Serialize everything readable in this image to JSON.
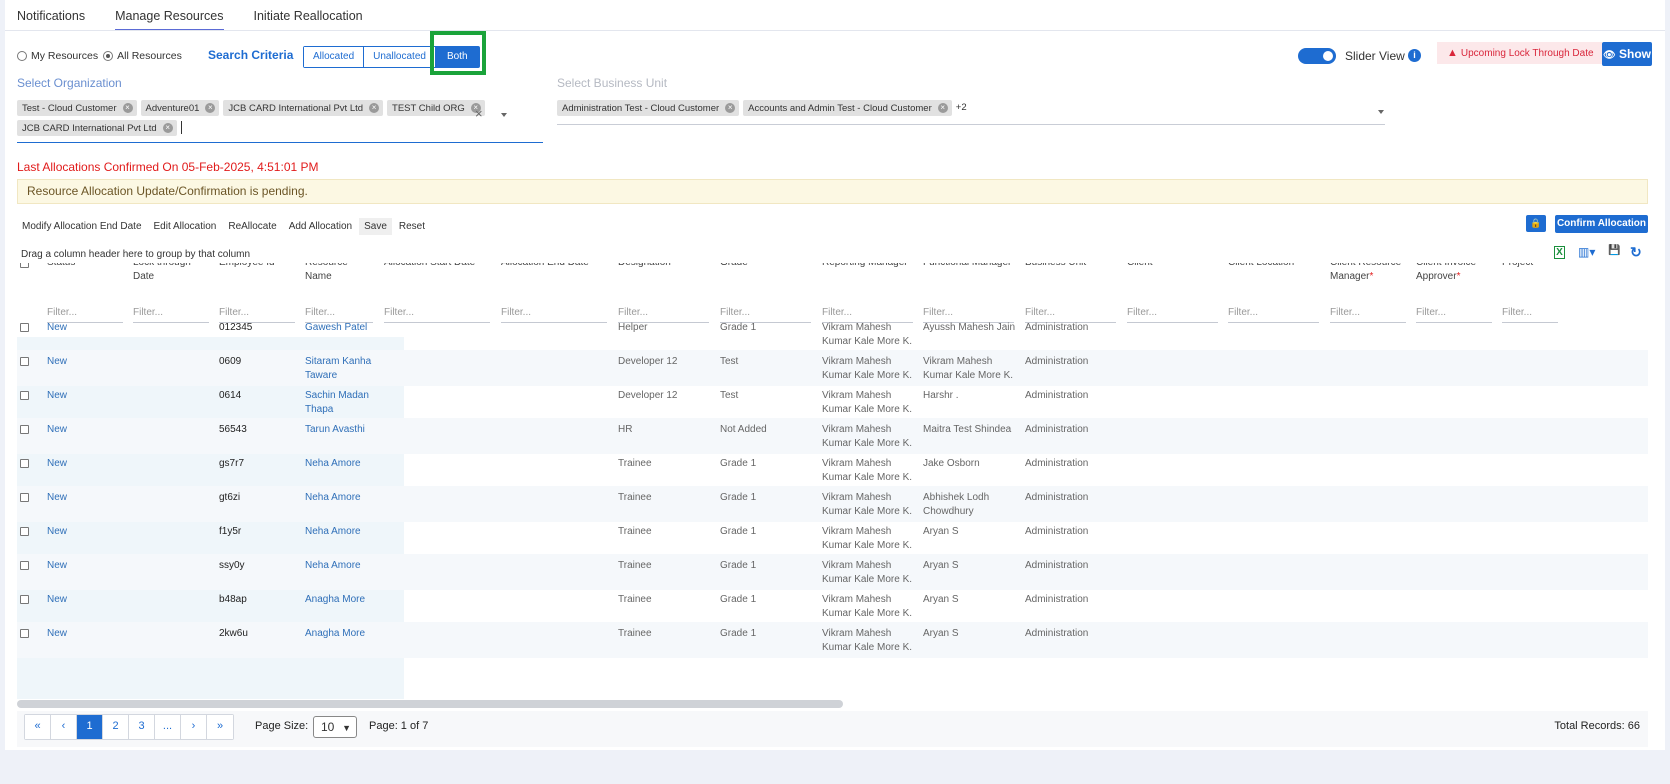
{
  "tabs": [
    "Notifications",
    "Manage Resources",
    "Initiate Reallocation"
  ],
  "scope": {
    "my": "My Resources",
    "all": "All Resources",
    "selected": "All Resources"
  },
  "search_criteria": {
    "label": "Search Criteria",
    "options": [
      "Allocated",
      "Unallocated",
      "Both"
    ],
    "selected": "Both"
  },
  "slider_view": {
    "label": "Slider View",
    "info_glyph": "i",
    "enabled": true
  },
  "lock_badge": {
    "icon": "warning-icon",
    "glyph": "▲",
    "text": "Upcoming Lock Through Date"
  },
  "show_button": {
    "icon": "eye-icon",
    "glyph": "👁",
    "label": "Show"
  },
  "organization": {
    "label": "Select Organization",
    "chips": [
      "Test - Cloud Customer",
      "Adventure01",
      "JCB CARD International Pvt Ltd",
      "TEST Child ORG",
      "JCB CARD International Pvt Ltd"
    ],
    "clear_glyph": "×",
    "chip_x_glyph": "×"
  },
  "business_unit": {
    "label": "Select Business Unit",
    "chips": [
      "Administration Test - Cloud Customer",
      "Accounts and Admin Test - Cloud Customer"
    ],
    "more": "+2"
  },
  "status_message": "Last Allocations Confirmed On 05-Feb-2025, 4:51:01 PM",
  "pending_alert": "Resource Allocation Update/Confirmation is pending.",
  "toolbar": {
    "buttons": [
      "Modify Allocation End Date",
      "Edit Allocation",
      "ReAllocate",
      "Add Allocation",
      "Save",
      "Reset"
    ],
    "lock_glyph": "🔒",
    "confirm_label": "Confirm Allocation"
  },
  "grid": {
    "group_hint": "Drag a column header here to group by that column",
    "tool_icons": {
      "excel": "X",
      "columns": "▥▾",
      "save": "💾",
      "refresh": "↻"
    },
    "filter_placeholder": "Filter...",
    "columns": [
      {
        "label": "Status",
        "required": false
      },
      {
        "label": "Lock through Date",
        "required": false
      },
      {
        "label": "Employee Id",
        "required": false
      },
      {
        "label": "Resource Name",
        "required": false
      },
      {
        "label": "Allocation Start Date",
        "required": true
      },
      {
        "label": "Allocation End Date",
        "required": true
      },
      {
        "label": "Designation",
        "required": false
      },
      {
        "label": "Grade",
        "required": false
      },
      {
        "label": "Reporting Manager",
        "required": false
      },
      {
        "label": "Functional Manager",
        "required": false
      },
      {
        "label": "Business Unit",
        "required": false
      },
      {
        "label": "Client",
        "required": true
      },
      {
        "label": "Client Location",
        "required": true
      },
      {
        "label": "Client Resource Manager",
        "required": true
      },
      {
        "label": "Client Invoice Approver",
        "required": true
      },
      {
        "label": "Project",
        "required": true
      }
    ],
    "rows": [
      [
        "New",
        "",
        "012345",
        "Gawesh Patel",
        "",
        "",
        "Helper",
        "Grade 1",
        "Vikram Mahesh Kumar Kale More K.",
        "Ayussh Mahesh Jain",
        "Administration",
        "",
        "",
        "",
        "",
        ""
      ],
      [
        "New",
        "",
        "0609",
        "Sitaram Kanha Taware",
        "",
        "",
        "Developer 12",
        "Test",
        "Vikram Mahesh Kumar Kale More K.",
        "Vikram Mahesh Kumar Kale More K.",
        "Administration",
        "",
        "",
        "",
        "",
        ""
      ],
      [
        "New",
        "",
        "0614",
        "Sachin Madan Thapa",
        "",
        "",
        "Developer 12",
        "Test",
        "Vikram Mahesh Kumar Kale More K.",
        "Harshr .",
        "Administration",
        "",
        "",
        "",
        "",
        ""
      ],
      [
        "New",
        "",
        "56543",
        "Tarun Avasthi",
        "",
        "",
        "HR",
        "Not Added",
        "Vikram Mahesh Kumar Kale More K.",
        "Maitra Test Shindea",
        "Administration",
        "",
        "",
        "",
        "",
        ""
      ],
      [
        "New",
        "",
        "gs7r7",
        "Neha Amore",
        "",
        "",
        "Trainee",
        "Grade 1",
        "Vikram Mahesh Kumar Kale More K.",
        "Jake Osborn",
        "Administration",
        "",
        "",
        "",
        "",
        ""
      ],
      [
        "New",
        "",
        "gt6zi",
        "Neha Amore",
        "",
        "",
        "Trainee",
        "Grade 1",
        "Vikram Mahesh Kumar Kale More K.",
        "Abhishek Lodh Chowdhury",
        "Administration",
        "",
        "",
        "",
        "",
        ""
      ],
      [
        "New",
        "",
        "f1y5r",
        "Neha Amore",
        "",
        "",
        "Trainee",
        "Grade 1",
        "Vikram Mahesh Kumar Kale More K.",
        "Aryan S",
        "Administration",
        "",
        "",
        "",
        "",
        ""
      ],
      [
        "New",
        "",
        "ssy0y",
        "Neha Amore",
        "",
        "",
        "Trainee",
        "Grade 1",
        "Vikram Mahesh Kumar Kale More K.",
        "Aryan S",
        "Administration",
        "",
        "",
        "",
        "",
        ""
      ],
      [
        "New",
        "",
        "b48ap",
        "Anagha More",
        "",
        "",
        "Trainee",
        "Grade 1",
        "Vikram Mahesh Kumar Kale More K.",
        "Aryan S",
        "Administration",
        "",
        "",
        "",
        "",
        ""
      ],
      [
        "New",
        "",
        "2kw6u",
        "Anagha More",
        "",
        "",
        "Trainee",
        "Grade 1",
        "Vikram Mahesh Kumar Kale More K.",
        "Aryan S",
        "Administration",
        "",
        "",
        "",
        "",
        ""
      ]
    ]
  },
  "pager": {
    "buttons": [
      "«",
      "‹",
      "1",
      "2",
      "3",
      "...",
      "›",
      "»"
    ],
    "active_page": "1",
    "page_size_label": "Page Size:",
    "page_size": "10",
    "page_info": "Page: 1 of 7",
    "total_records": "Total Records: 66"
  },
  "colors": {
    "accent": "#1e6cd1",
    "required": "#e11b1b",
    "highlight": "#1aa33a"
  }
}
